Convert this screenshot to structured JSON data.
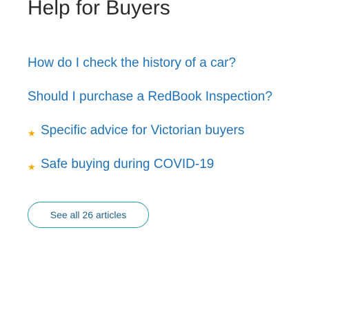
{
  "help": {
    "title": "Help for Buyers",
    "articles": [
      {
        "label": "How do I check the history of a car?",
        "featured": false
      },
      {
        "label": "Should I purchase a RedBook Inspection?",
        "featured": false
      },
      {
        "label": "Specific advice for Victorian buyers",
        "featured": true
      },
      {
        "label": "Safe buying during COVID-19",
        "featured": true
      }
    ],
    "star_glyph": "★",
    "see_all_label": "See all 26 articles"
  },
  "colors": {
    "link": "#1f72b8",
    "star": "#f2a900",
    "button_border": "#2a9ab5",
    "heading": "#2b2b2b"
  }
}
